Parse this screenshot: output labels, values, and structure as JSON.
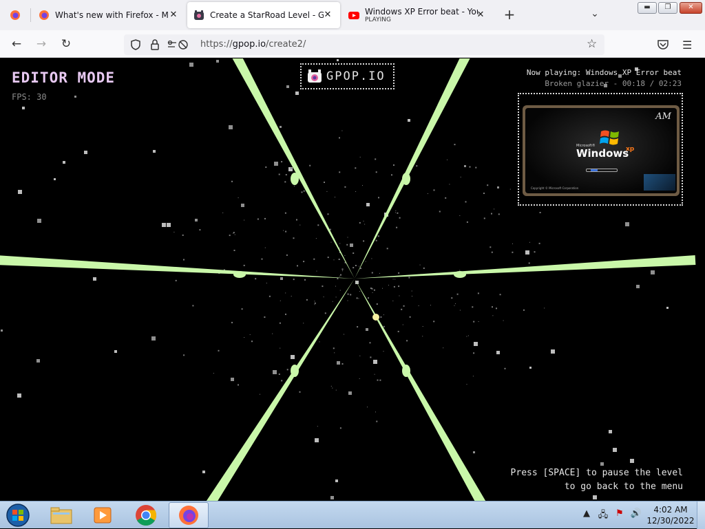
{
  "browser": {
    "tabs": [
      {
        "title": "What's new with Firefox - More",
        "subtitle": "",
        "icon": "firefox-icon"
      },
      {
        "title": "Create a StarRoad Level - Gpop.",
        "subtitle": "",
        "icon": "gpop-icon",
        "active": true
      },
      {
        "title": "Windows XP Error beat - YouTu",
        "subtitle": "PLAYING",
        "icon": "youtube-icon"
      }
    ],
    "url_prefix": "https://",
    "url_host": "gpop.io",
    "url_path": "/create2/",
    "window_controls": {
      "minimize": "▬",
      "maximize": "❐",
      "close": "✕"
    }
  },
  "game": {
    "mode_title": "EDITOR MODE",
    "fps_label": "FPS: 30",
    "logo_text": "GPOP.IO",
    "now_playing": "Now playing: Windows XP Error beat",
    "track_meta": "Broken glazier - 00:18 / 02:23",
    "video": {
      "watermark": "AM",
      "ms_label": "Microsoft®",
      "windows_label": "Windows",
      "xp_label": "xp",
      "copyright": "Copyright © Microsoft Corporation"
    },
    "hint_line1": "Press [SPACE] to pause the level",
    "hint_line2": "to go back to the menu",
    "lane_color": "#c9f7a9"
  },
  "taskbar": {
    "time": "4:02 AM",
    "date": "12/30/2022",
    "apps": [
      "file-explorer-icon",
      "media-player-icon",
      "chrome-icon",
      "firefox-icon"
    ]
  }
}
